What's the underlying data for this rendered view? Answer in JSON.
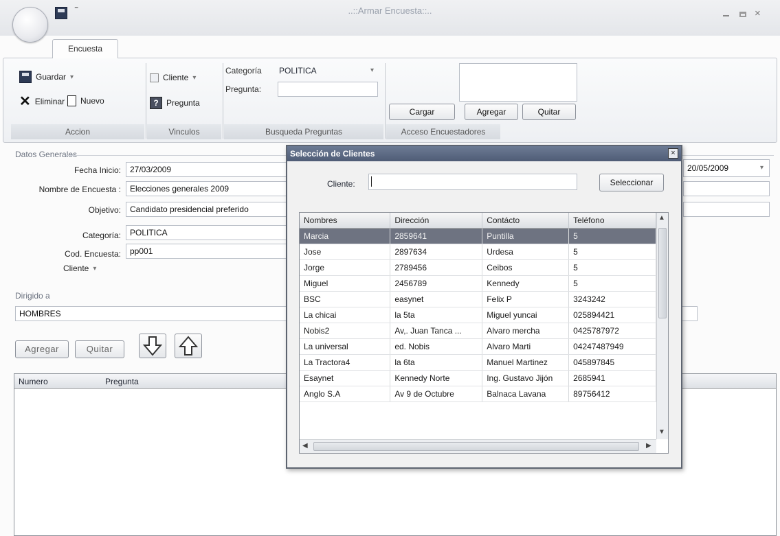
{
  "window": {
    "title": "..::Armar Encuesta::..",
    "qat_menu": "⁼",
    "close": "×",
    "tab": "Encuesta"
  },
  "ribbon": {
    "accion": {
      "guardar": "Guardar",
      "eliminar": "Eliminar",
      "nuevo": "Nuevo",
      "label": "Accion"
    },
    "vinculos": {
      "cliente": "Cliente",
      "pregunta": "Pregunta",
      "label": "Vinculos"
    },
    "busqueda": {
      "categoria_label": "Categoría",
      "categoria_value": "POLITICA",
      "pregunta_label": "Pregunta:",
      "pregunta_value": "",
      "label": "Busqueda Preguntas"
    },
    "encuestadores": {
      "cargar": "Cargar",
      "agregar": "Agregar",
      "quitar": "Quitar",
      "label": "Acceso Encuestadores"
    }
  },
  "datos": {
    "title": "Datos Generales",
    "fecha_inicio_label": "Fecha Inicio:",
    "fecha_inicio": "27/03/2009",
    "fecha_fin": "20/05/2009",
    "nombre_label": "Nombre de Encuesta :",
    "nombre": "Elecciones generales 2009",
    "objetivo_label": "Objetivo:",
    "objetivo": "Candidato presidencial preferido",
    "categoria_label": "Categoría:",
    "categoria": "POLITICA",
    "cod_label": "Cod. Encuesta:",
    "cod": "pp001",
    "cliente_label": "Cliente"
  },
  "dirigido": {
    "title": "Dirigido a",
    "value": "HOMBRES"
  },
  "questions": {
    "agregar": "Agregar",
    "quitar": "Quitar",
    "columns": [
      "Numero",
      "Pregunta"
    ]
  },
  "dialog": {
    "title": "Selección de Clientes",
    "close": "×",
    "cliente_label": "Cliente:",
    "cliente_value": "",
    "seleccionar": "Seleccionar",
    "columns": [
      "Nombres",
      "Dirección",
      "Contácto",
      "Teléfono"
    ],
    "rows": [
      [
        "Marcia",
        "2859641",
        "Puntilla",
        "5"
      ],
      [
        "Jose",
        "2897634",
        "Urdesa",
        "5"
      ],
      [
        "Jorge",
        "2789456",
        "Ceibos",
        "5"
      ],
      [
        "Miguel",
        "2456789",
        "Kennedy",
        "5"
      ],
      [
        "BSC",
        "easynet",
        "Felix P",
        "3243242"
      ],
      [
        "La chicai",
        "la 5ta",
        "Miguel yuncai",
        "025894421"
      ],
      [
        "Nobis2",
        "Av,. Juan Tanca ...",
        "Alvaro mercha",
        "0425787972"
      ],
      [
        "La universal",
        "ed. Nobis",
        "Alvaro Marti",
        "04247487949"
      ],
      [
        "La Tractora4",
        "la 6ta",
        "Manuel Martinez",
        "045897845"
      ],
      [
        "Esaynet",
        "Kennedy Norte",
        "Ing. Gustavo Jijón",
        "2685941"
      ],
      [
        "Anglo S.A",
        "Av 9 de Octubre",
        "Balnaca Lavana",
        "89756412"
      ]
    ]
  }
}
